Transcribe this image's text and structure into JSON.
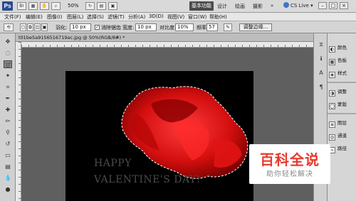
{
  "app": {
    "logo": "Ps",
    "zoom": "50%",
    "workspace_active": "基本功能",
    "workspaces": [
      "设计",
      "绘画",
      "摄影"
    ],
    "workspaces_more": "»",
    "cslive": "CS Live",
    "cslive_arrow": "▾",
    "window_controls": [
      "–",
      "□",
      "×"
    ]
  },
  "menu": [
    "文件(F)",
    "编辑(E)",
    "图像(I)",
    "图层(L)",
    "选择(S)",
    "滤镜(T)",
    "分析(A)",
    "3D(D)",
    "视图(V)",
    "窗口(W)",
    "帮助(H)"
  ],
  "options": {
    "feather_label": "羽化:",
    "feather_value": "10 px",
    "antialias_label": "消除锯齿",
    "width_label": "宽度:",
    "width_value": "10 px",
    "contrast_label": "对比度:",
    "contrast_value": "10%",
    "frequency_label": "频率:",
    "frequency_value": "57",
    "refine_label": "调整边缘..."
  },
  "document": {
    "tab_label": "t01be5a9156516719ac.jpg @ 50%(RGB/8#) *",
    "close": "×",
    "canvas_text_line1": "HAPPY",
    "canvas_text_line2": "VALENTINE'S DAY!"
  },
  "panels": [
    {
      "label": "颜色",
      "icon": "palette-icon"
    },
    {
      "label": "色板",
      "icon": "swatches-icon"
    },
    {
      "label": "样式",
      "icon": "styles-icon"
    },
    {
      "label": "调整",
      "icon": "adjustments-icon"
    },
    {
      "label": "蒙版",
      "icon": "masks-icon"
    },
    {
      "label": "图层",
      "icon": "layers-icon"
    },
    {
      "label": "通道",
      "icon": "channels-icon"
    },
    {
      "label": "路径",
      "icon": "paths-icon"
    }
  ],
  "watermark": {
    "title": "百科全说",
    "subtitle": "助你轻松解决"
  },
  "colors": {
    "rose": "#d40f0f",
    "accent": "#e8392d"
  }
}
